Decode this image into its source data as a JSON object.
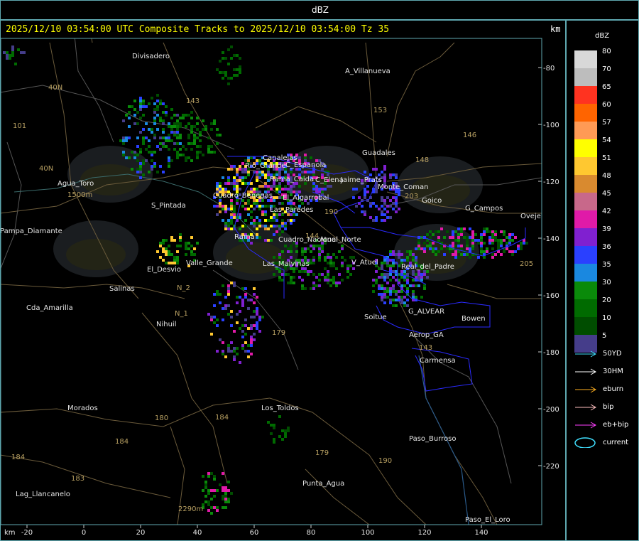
{
  "top_bar": {
    "title": "dBZ"
  },
  "header": {
    "text": "2025/12/10 03:54:00 UTC Composite Tracks to 2025/12/10 03:54:00 Tz 35",
    "unit": "km",
    "unit_bottom": "km"
  },
  "axes": {
    "x_ticks": [
      "-20",
      "0",
      "20",
      "40",
      "60",
      "80",
      "100",
      "120",
      "140"
    ],
    "y_ticks": [
      "-80",
      "-100",
      "-120",
      "-140",
      "-160",
      "-180",
      "-200",
      "-220"
    ]
  },
  "colors": {
    "frame": "#5fa8b0",
    "background": "#000000",
    "header": "#ffff00",
    "boundary": "#2a2aff",
    "road": "#b8a062"
  },
  "legend": {
    "title": "dBZ",
    "scale": [
      {
        "value": "80",
        "color": "#d8d8d8"
      },
      {
        "value": "70",
        "color": "#bdbdbd"
      },
      {
        "value": "65",
        "color": "#ff3320"
      },
      {
        "value": "60",
        "color": "#ff6400"
      },
      {
        "value": "57",
        "color": "#ff9a55"
      },
      {
        "value": "54",
        "color": "#ffff00"
      },
      {
        "value": "51",
        "color": "#ffc830"
      },
      {
        "value": "48",
        "color": "#d98a2f"
      },
      {
        "value": "45",
        "color": "#c8688a"
      },
      {
        "value": "42",
        "color": "#e01aa8"
      },
      {
        "value": "39",
        "color": "#8020d0"
      },
      {
        "value": "36",
        "color": "#2a40ff"
      },
      {
        "value": "35",
        "color": "#1a88e0"
      },
      {
        "value": "30",
        "color": "#0a8a0a"
      },
      {
        "value": "20",
        "color": "#006b00"
      },
      {
        "value": "10",
        "color": "#004d00"
      },
      {
        "value": "5",
        "color": "#453d8a"
      }
    ],
    "tracks": [
      {
        "label": "50YD",
        "color": "#40e0ff"
      },
      {
        "label": "30HM",
        "color": "#ffffff"
      },
      {
        "label": "eburn",
        "color": "#ffb020"
      },
      {
        "label": "bip",
        "color": "#ffc0c0"
      },
      {
        "label": "eb+bip",
        "color": "#ff40ff"
      },
      {
        "label": "current",
        "color": "#40e0ff"
      }
    ]
  },
  "places": [
    "Divisadero",
    "A_Villanueva",
    "Agua_Toro",
    "S_Pintada",
    "Pampa_Diamante",
    "El_Desvio",
    "Salinas",
    "Valle_Grande",
    "Las_Malvinas",
    "Atuel_Norte",
    "V_Atuel",
    "Real_del_Padre",
    "G_Campos",
    "Goico",
    "Guadales",
    "El_Algarrobal",
    "Rama_Caida",
    "Cda_Amarilla",
    "Nihuil",
    "Cuadro_Benegas",
    "Los_Toldos",
    "Morados",
    "Paso_Burroso",
    "Punta_Agua",
    "Lag_Llancanelo",
    "Bowen",
    "Carmensa",
    "G_ALVEAR",
    "Soitue",
    "Aerop_GA",
    "Paso_El_Loro",
    "Ovejeria",
    "Monte_Coman",
    "C_Espanola",
    "C_Elena",
    "Jaime_Prats",
    "Rio_Grande",
    "Las_Paredes",
    "Rama",
    "Cuadro_Nacional",
    "Canalejas"
  ],
  "roads": [
    "40N",
    "40N",
    "143",
    "153",
    "146",
    "148",
    "203",
    "101",
    "144",
    "180",
    "184",
    "184",
    "183",
    "179",
    "190",
    "143",
    "184",
    "179",
    "205",
    "190",
    "2290m",
    "1500m",
    "N_1",
    "N_2"
  ]
}
